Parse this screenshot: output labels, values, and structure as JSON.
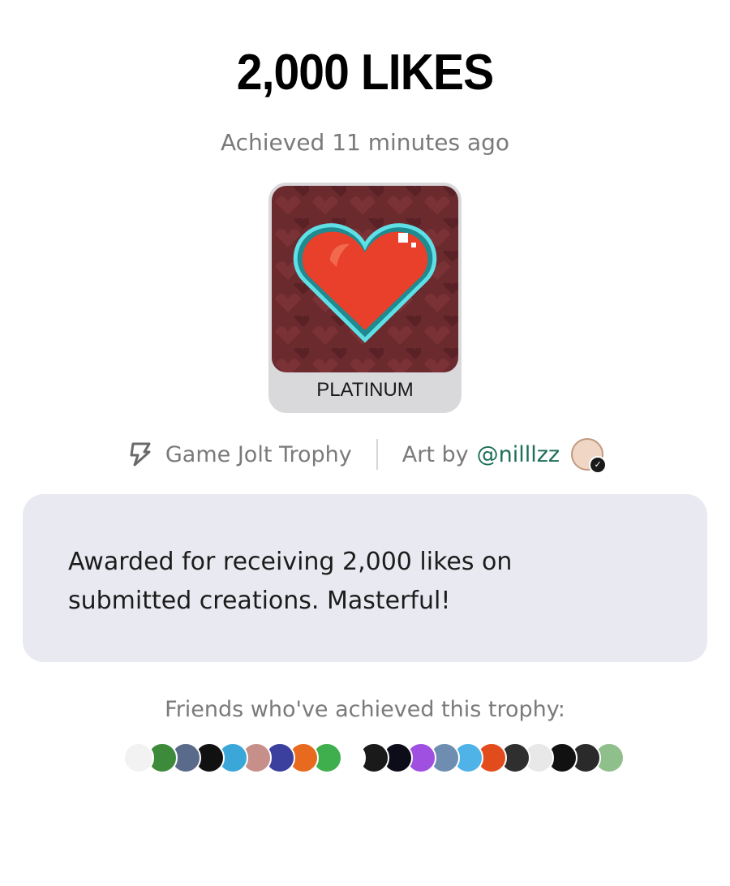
{
  "trophy": {
    "title": "2,000 LIKES",
    "achieved": "Achieved 11 minutes ago",
    "tier": "PLATINUM",
    "source_label": "Game Jolt Trophy",
    "art_by_label": "Art by",
    "artist_handle": "@nilllzz",
    "description": "Awarded for receiving 2,000 likes on submitted creations. Masterful!"
  },
  "friends": {
    "label": "Friends who've achieved this trophy:",
    "avatar_colors": [
      "#f2f2f2",
      "#3c8a3a",
      "#5a6a8a",
      "#111111",
      "#3aa7d8",
      "#c78f8a",
      "#3b3f9e",
      "#e86a1f",
      "#3fae4c",
      "#ffffff",
      "#1a1a1a",
      "#0d0d1a",
      "#a050e0",
      "#6f8db0",
      "#4fb3e8",
      "#e24b1c",
      "#2f2f2f",
      "#e8e8e8",
      "#111111",
      "#2a2a2a",
      "#8fbf8a"
    ]
  },
  "colors": {
    "accent_link": "#1e6e5a",
    "card_bg": "#e9e9f1",
    "tier_bg": "#d9d9dc"
  }
}
